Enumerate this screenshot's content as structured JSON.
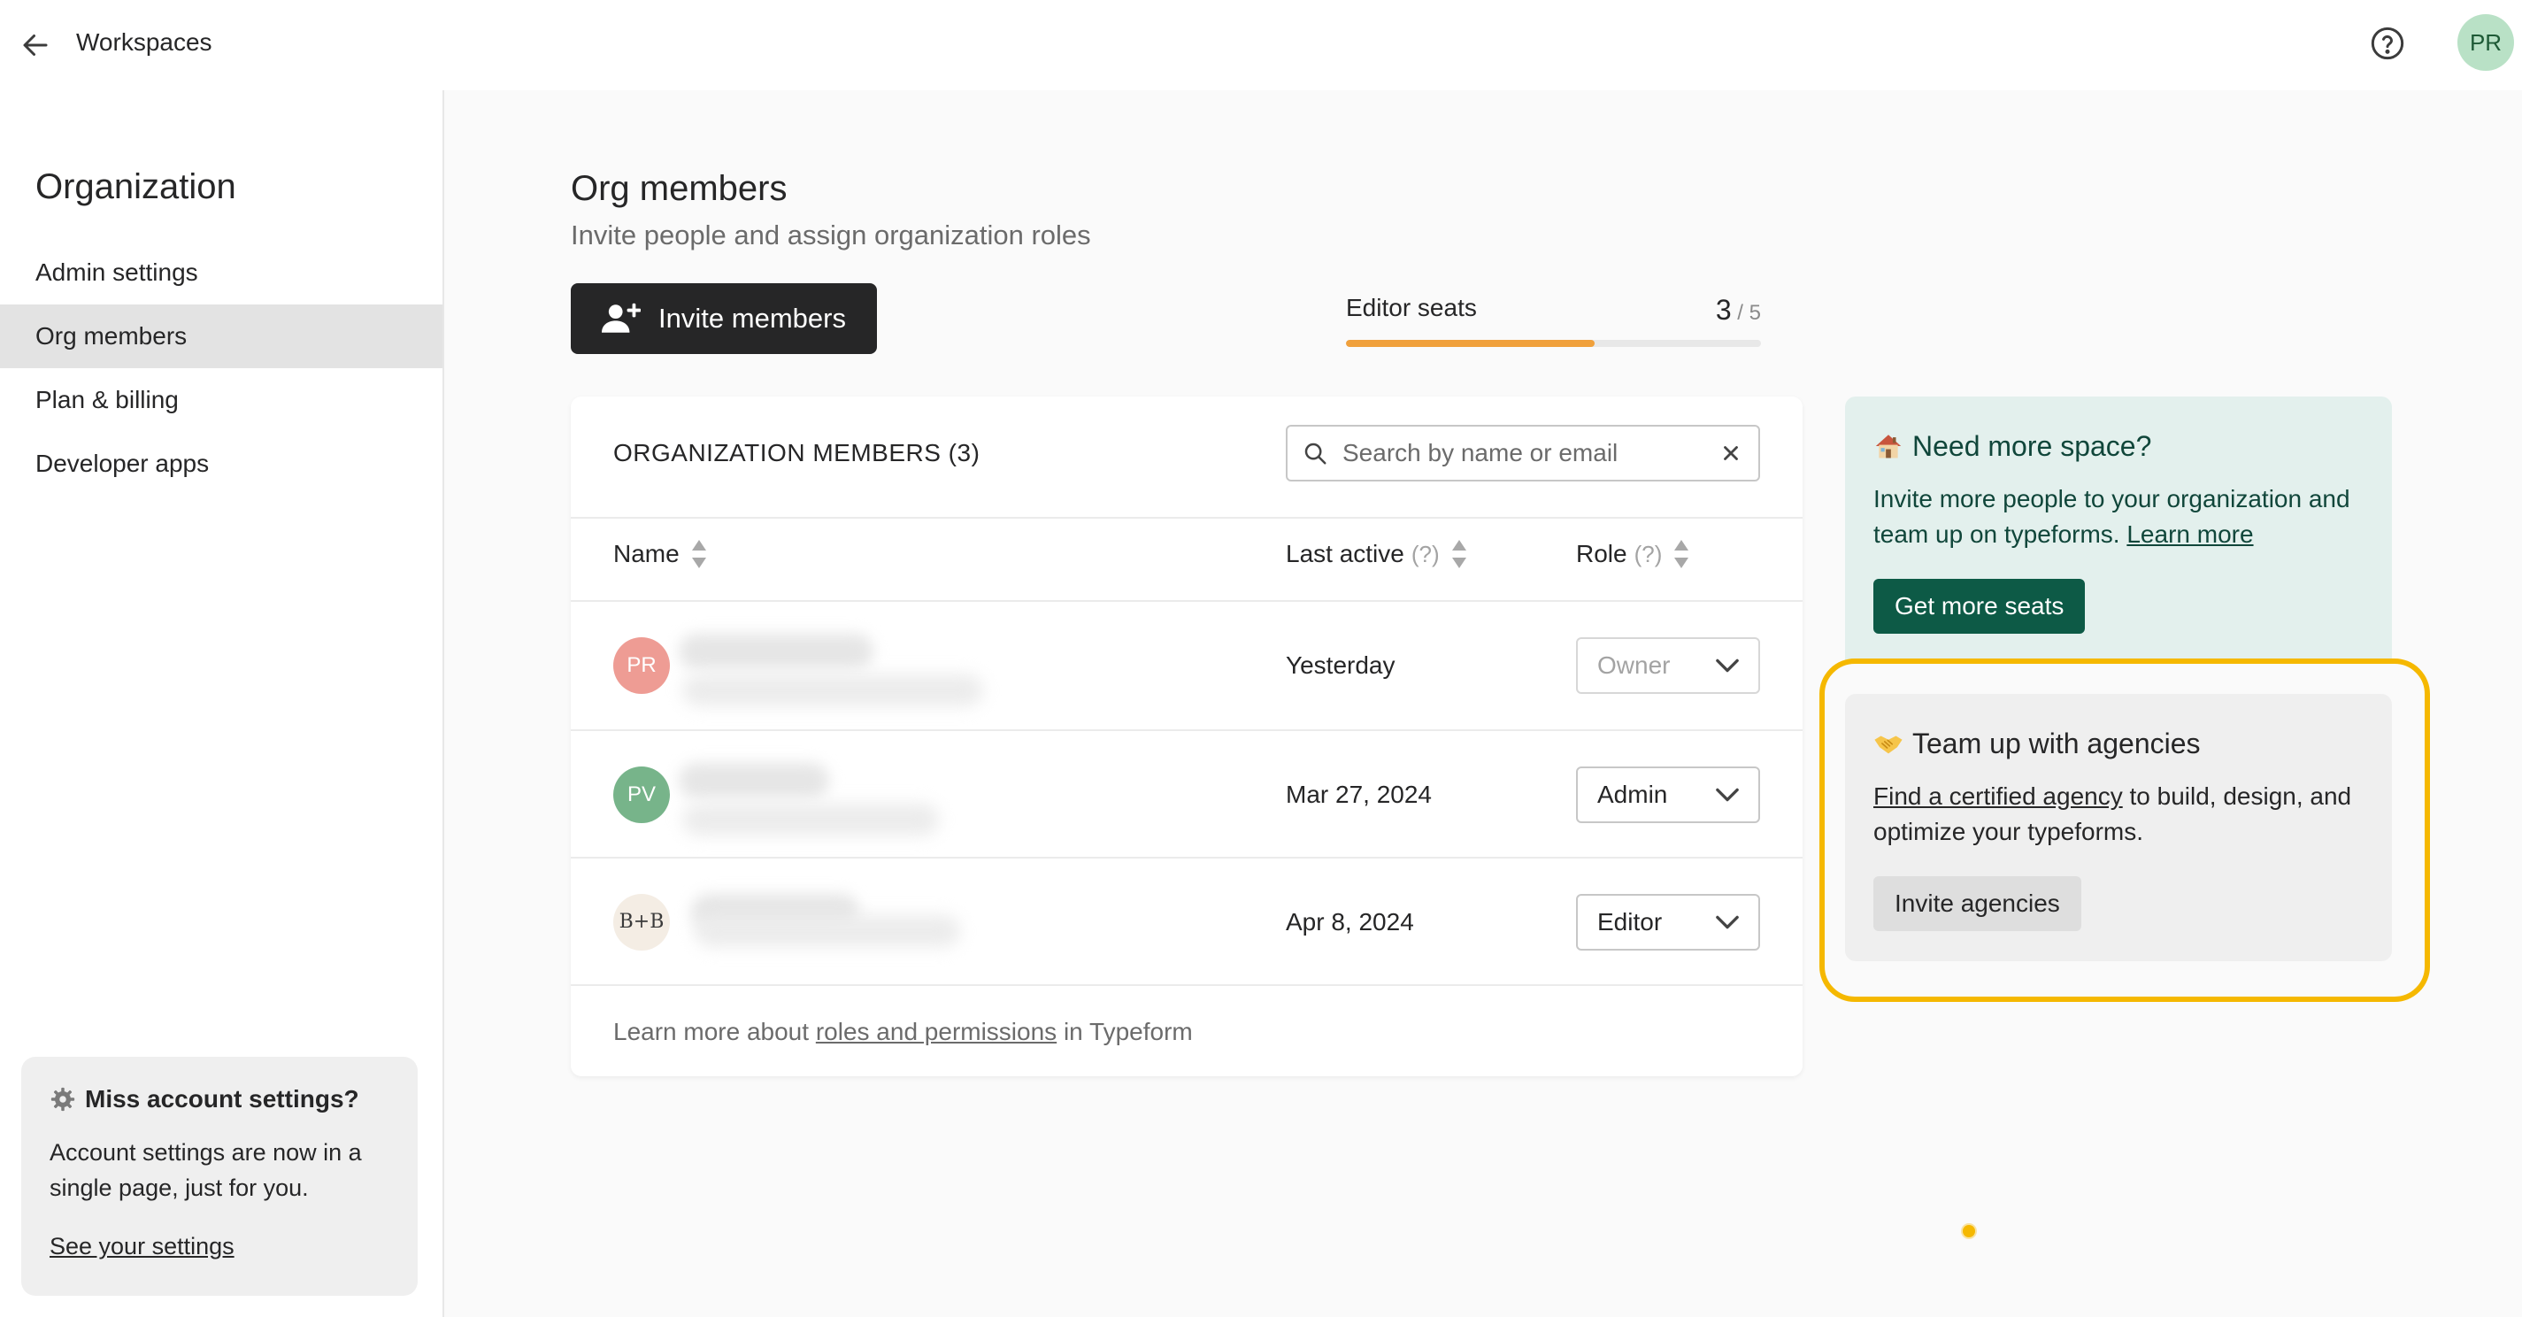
{
  "header": {
    "back_label": "Workspaces",
    "avatar_initials": "PR"
  },
  "sidebar": {
    "title": "Organization",
    "items": [
      {
        "label": "Admin settings",
        "active": false
      },
      {
        "label": "Org members",
        "active": true
      },
      {
        "label": "Plan & billing",
        "active": false
      },
      {
        "label": "Developer apps",
        "active": false
      }
    ],
    "promo": {
      "title": "Miss account settings?",
      "text": "Account settings are now in a single page, just for you.",
      "link": "See your settings"
    }
  },
  "main": {
    "title": "Org members",
    "subtitle": "Invite people and assign organization roles",
    "invite_button": "Invite members",
    "seats": {
      "label": "Editor seats",
      "used": "3",
      "separator": "/",
      "total": "5",
      "fill_fraction": 0.6,
      "fill_color": "#f0a03b"
    },
    "table": {
      "heading": "ORGANIZATION MEMBERS (3)",
      "search_placeholder": "Search by name or email",
      "columns": {
        "name": "Name",
        "last_active": "Last active",
        "role": "Role",
        "hint": "(?)"
      },
      "rows": [
        {
          "initials": "PR",
          "avatar_color": "#ee9c94",
          "last_active": "Yesterday",
          "role": "Owner",
          "disabled": true
        },
        {
          "initials": "PV",
          "avatar_color": "#77b48a",
          "last_active": "Mar 27, 2024",
          "role": "Admin",
          "disabled": false
        },
        {
          "initials": "B+B",
          "avatar_color": "#f4ede4",
          "last_active": "Apr 8, 2024",
          "role": "Editor",
          "disabled": false
        }
      ],
      "footer": {
        "prefix": "Learn more about",
        "link": "roles and permissions",
        "suffix": "in Typeform"
      }
    }
  },
  "cards": {
    "space": {
      "icon": "house-icon",
      "title": "Need more space?",
      "text": "Invite more people to your organization and team up on typeforms.",
      "link": "Learn more",
      "button": "Get more seats"
    },
    "agency": {
      "icon": "handshake-icon",
      "title": "Team up with agencies",
      "link": "Find a certified agency",
      "text": "to build, design, and optimize your typeforms.",
      "button": "Invite agencies",
      "highlight_color": "#f5b800"
    }
  }
}
